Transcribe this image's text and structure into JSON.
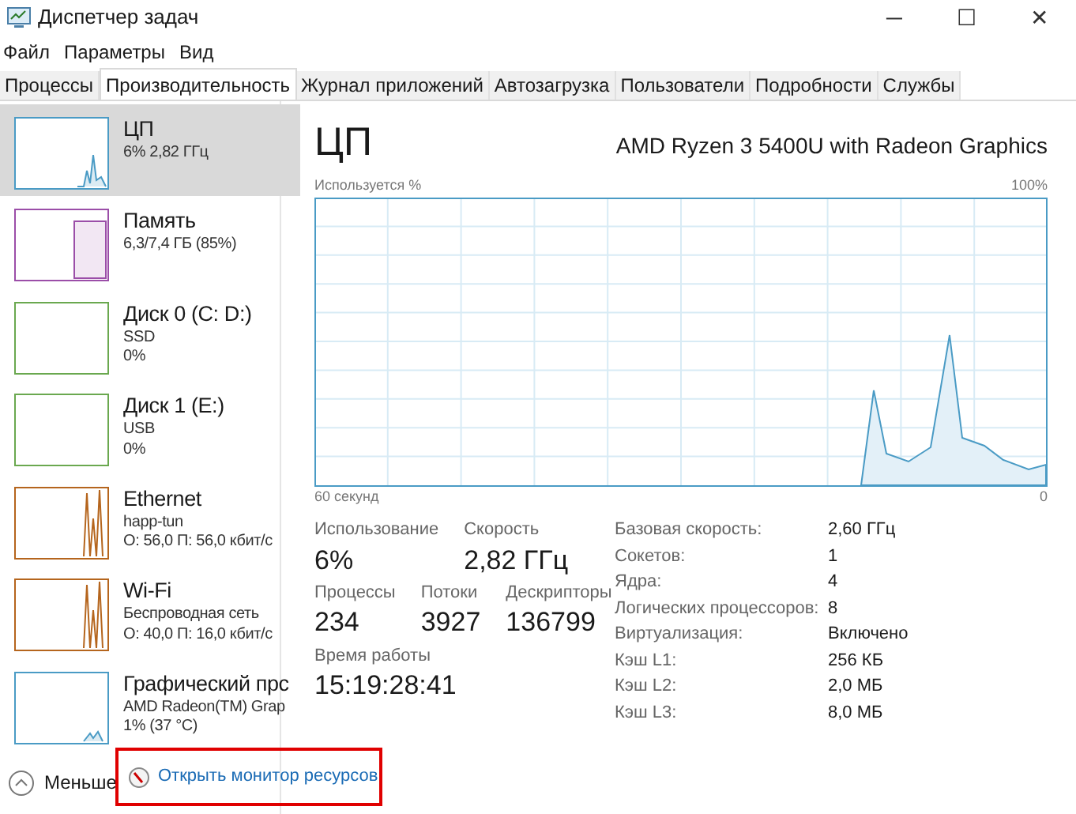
{
  "window": {
    "title": "Диспетчер задач",
    "controls": [
      "─",
      "☐",
      "✕"
    ]
  },
  "menu": [
    "Файл",
    "Параметры",
    "Вид"
  ],
  "tabs": [
    {
      "label": "Процессы",
      "selected": false
    },
    {
      "label": "Производительность",
      "selected": true
    },
    {
      "label": "Журнал приложений",
      "selected": false
    },
    {
      "label": "Автозагрузка",
      "selected": false
    },
    {
      "label": "Пользователи",
      "selected": false
    },
    {
      "label": "Подробности",
      "selected": false
    },
    {
      "label": "Службы",
      "selected": false
    }
  ],
  "sidebar": {
    "items": [
      {
        "kind": "cpu",
        "title": "ЦП",
        "lines": [
          "6% 2,82 ГГц"
        ],
        "color": "#4a9bc5",
        "selected": true
      },
      {
        "kind": "memory",
        "title": "Память",
        "lines": [
          "6,3/7,4 ГБ (85%)"
        ],
        "color": "#9b4ea8",
        "selected": false
      },
      {
        "kind": "disk",
        "title": "Диск 0 (C: D:)",
        "lines": [
          "SSD",
          "0%"
        ],
        "color": "#6aa84f",
        "selected": false
      },
      {
        "kind": "disk",
        "title": "Диск 1 (E:)",
        "lines": [
          "USB",
          "0%"
        ],
        "color": "#6aa84f",
        "selected": false
      },
      {
        "kind": "network",
        "title": "Ethernet",
        "lines": [
          "happ-tun",
          "О: 56,0 П: 56,0 кбит/с"
        ],
        "color": "#b5651d",
        "selected": false
      },
      {
        "kind": "network",
        "title": "Wi-Fi",
        "lines": [
          "Беспроводная сеть",
          "О: 40,0 П: 16,0 кбит/с"
        ],
        "color": "#b5651d",
        "selected": false
      },
      {
        "kind": "gpu",
        "title": "Графический прс",
        "lines": [
          "AMD Radeon(TM) Grap",
          "1% (37 °C)"
        ],
        "color": "#4a9bc5",
        "selected": false
      }
    ]
  },
  "main": {
    "title": "ЦП",
    "model": "AMD Ryzen 3 5400U with Radeon Graphics",
    "graph_label": "Используется %",
    "graph_max": "100%",
    "graph_time": "60 секунд",
    "graph_min": "0",
    "stats": [
      [
        {
          "label": "Использование",
          "value": "6%"
        },
        {
          "label": "Скорость",
          "value": "2,82 ГГц"
        }
      ],
      [
        {
          "label": "Процессы",
          "value": "234"
        },
        {
          "label": "Потоки",
          "value": "3927"
        },
        {
          "label": "Дескрипторы",
          "value": "136799"
        }
      ],
      [
        {
          "label": "Время работы",
          "value": "15:19:28:41"
        }
      ]
    ],
    "details": [
      {
        "label": "Базовая скорость:",
        "value": "2,60 ГГц"
      },
      {
        "label": "Сокетов:",
        "value": "1"
      },
      {
        "label": "Ядра:",
        "value": "4"
      },
      {
        "label": "Логических процессоров:",
        "value": "8"
      },
      {
        "label": "Виртуализация:",
        "value": "Включено"
      },
      {
        "label": "Кэш L1:",
        "value": "256 КБ"
      },
      {
        "label": "Кэш L2:",
        "value": "2,0 МБ"
      },
      {
        "label": "Кэш L3:",
        "value": "8,0 МБ"
      }
    ]
  },
  "footer": {
    "less": "Меньше",
    "link": "Открыть монитор ресурсов",
    "highlighted": true
  }
}
